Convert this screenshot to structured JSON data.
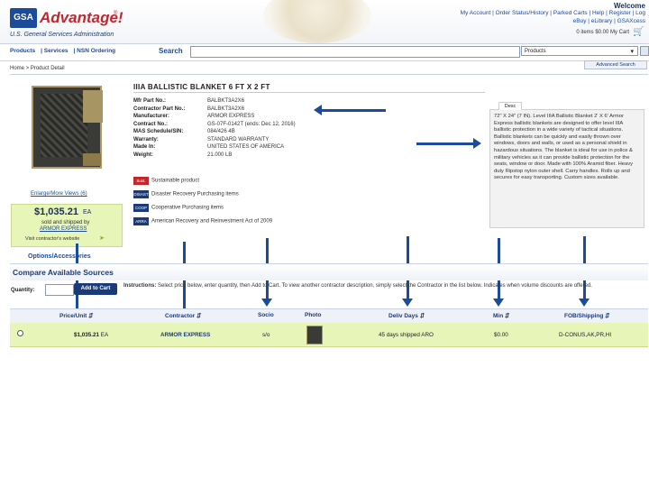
{
  "header": {
    "logo_text": "GSA",
    "brand": "Advantage!",
    "brand_mark": "®",
    "subtitle": "U.S. General Services Administration",
    "welcome": "Welcome",
    "top_links": "My Account | Order Status/History | Parked Carts | Help | Register | Log",
    "top_links_2": "eBuy | eLibrary | GSAXcess",
    "cart_text": "0 items $0.00  My Cart"
  },
  "nav": {
    "items": [
      "Products",
      "Services",
      "NSN Ordering"
    ],
    "search_label": "Search",
    "search_value": "",
    "scope": "Products",
    "advanced_search": "Advanced Search",
    "breadcrumb": "Home > Product Detail"
  },
  "product": {
    "title": "IIIA BALLISTIC BLANKET 6 FT X 2 FT",
    "enlarge_link": "Enlarge/More Views (6)",
    "price": "$1,035.21",
    "price_unit": "EA",
    "sold_by": "sold and shipped by",
    "vendor": "ARMOR EXPRESS",
    "visit_site": "Visit contractor's website",
    "options_link": "Options/Accessories",
    "details": [
      {
        "label": "Mfr Part No.:",
        "value": "BALBKT3A2X6"
      },
      {
        "label": "Contractor Part No.:",
        "value": "BALBKT3A2X6"
      },
      {
        "label": "Manufacturer:",
        "value": "ARMOR EXPRESS"
      },
      {
        "label": "Contract No.:",
        "value": "GS-07F-0142T (ends: Dec 12, 2016)"
      },
      {
        "label": "MAS Schedule/SIN:",
        "value": "084/426 4B"
      },
      {
        "label": "Warranty:",
        "value": "STANDARD WARRANTY"
      },
      {
        "label": "Made In:",
        "value": "UNITED STATES OF AMERICA"
      },
      {
        "label": "Weight:",
        "value": "21.000 LB"
      }
    ],
    "programs": [
      {
        "badge": "Sust.",
        "label": "Sustainable product"
      },
      {
        "badge": "DISAST",
        "label": "Disaster Recovery Purchasing items"
      },
      {
        "badge": "COOP",
        "label": "Cooperative Purchasing items"
      },
      {
        "badge": "ARRA",
        "label": "American Recovery and Reinvestment Act of 2009"
      }
    ],
    "desc_tab": "Desc",
    "description": "72\" X 24\" (7 IN). Level IIIA Ballistic Blanket 2' X 6' Armor Express ballistic blankets are designed to offer level IIIA ballistic protection in a wide variety of tactical situations. Ballistic blankets can be quickly and easily thrown over windows, doors and walls, or used as a personal shield in hazardous situations. The blanket is ideal for use in police & military vehicles as it can provide ballistic protection for the seats, window or door. Made with 100% Aramid fiber. Heavy duty Ripstop nylon outer shell. Carry handles. Rolls up and secures for easy transporting. Custom sizes available."
  },
  "compare": {
    "title": "Compare Available Sources",
    "qty_label": "Quantity:",
    "qty_value": "",
    "add_to_cart": "Add to Cart",
    "instructions_label": "Instructions:",
    "instructions": "Select price below, enter quantity, then Add to Cart. To view another contractor description, simply select the Contractor in the list below. Indicates when volume discounts are offered.",
    "columns": [
      "Price/Unit",
      "Contractor",
      "Socio",
      "Photo",
      "Deliv Days",
      "Min",
      "FOB/Shipping"
    ],
    "rows": [
      {
        "price": "$1,035.21",
        "unit": "EA",
        "contractor": "ARMOR EXPRESS",
        "socio": "s/o",
        "deliv": "45 days shipped ARO",
        "min": "$0.00",
        "fob": "D-CONUS,AK,PR,HI"
      }
    ]
  },
  "colors": {
    "accent": "#1c3a78",
    "brand_red": "#c0282e",
    "highlight_row": "#e8f5b8",
    "arrow": "#1c4b9a"
  }
}
